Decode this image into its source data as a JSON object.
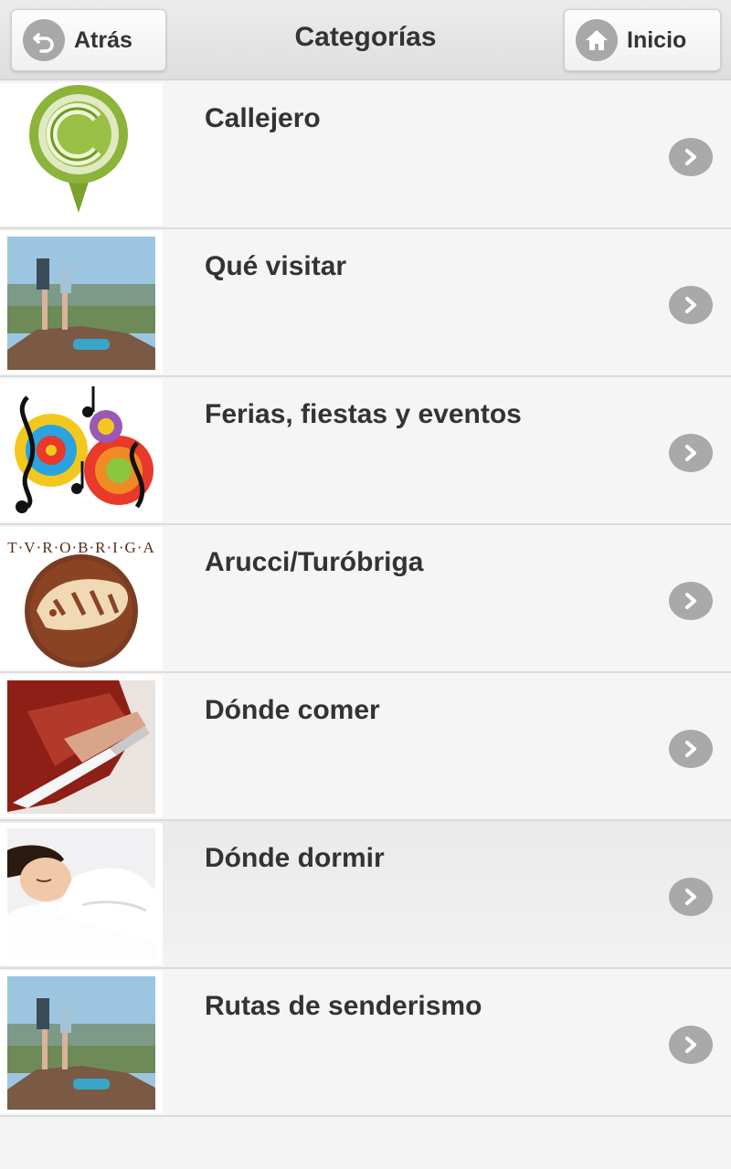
{
  "header": {
    "back_label": "Atrás",
    "title": "Categorías",
    "home_label": "Inicio"
  },
  "categories": [
    {
      "label": "Callejero",
      "image": "callejero-map-pin-logo"
    },
    {
      "label": "Qué visitar",
      "image": "hikers-on-mountain-photo"
    },
    {
      "label": "Ferias, fiestas y eventos",
      "image": "music-notes-circles-illustration"
    },
    {
      "label": "Arucci/Turóbriga",
      "image": "turobriga-boar-emblem",
      "emblem_text": "T·V·R·O·B·R·I·G·A"
    },
    {
      "label": "Dónde comer",
      "image": "ham-slicing-photo"
    },
    {
      "label": "Dónde dormir",
      "image": "sleeping-woman-photo"
    },
    {
      "label": "Rutas de senderismo",
      "image": "hikers-on-mountain-photo"
    }
  ],
  "colors": {
    "header_bg": "#e4e4e4",
    "row_bg": "#f5f5f5",
    "active_row_bg": "#ececec",
    "icon_circle": "#a9a9a9",
    "text": "#333333"
  }
}
